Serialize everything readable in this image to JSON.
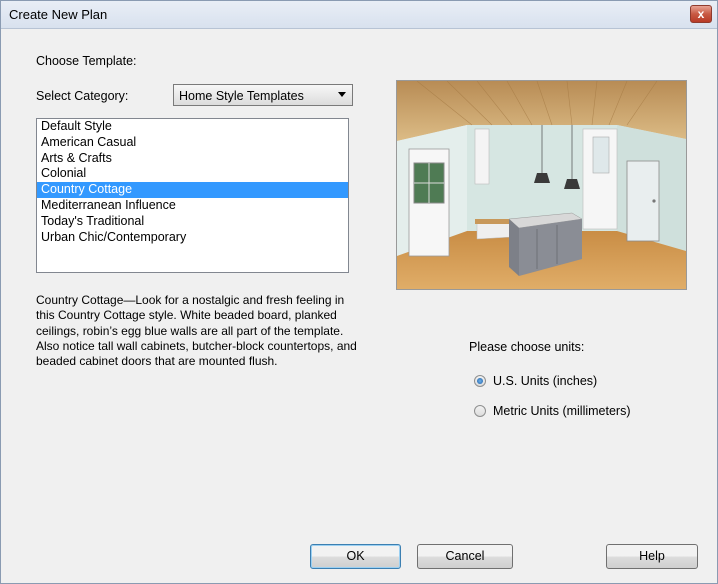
{
  "window": {
    "title": "Create New Plan",
    "close_label": "x"
  },
  "choose_template_label": "Choose Template:",
  "category": {
    "label": "Select Category:",
    "selected": "Home Style Templates"
  },
  "templates": [
    {
      "label": "Default Style",
      "selected": false
    },
    {
      "label": "American Casual",
      "selected": false
    },
    {
      "label": "Arts & Crafts",
      "selected": false
    },
    {
      "label": "Colonial",
      "selected": false
    },
    {
      "label": "Country Cottage",
      "selected": true
    },
    {
      "label": "Mediterranean Influence",
      "selected": false
    },
    {
      "label": "Today's Traditional",
      "selected": false
    },
    {
      "label": "Urban Chic/Contemporary",
      "selected": false
    }
  ],
  "description": "Country Cottage—Look for a nostalgic and fresh feeling in this Country Cottage style. White beaded board, planked ceilings, robin’s egg blue walls are all part of the template. Also notice tall wall cabinets, butcher-block countertops, and beaded cabinet doors that are mounted flush.",
  "units": {
    "label": "Please choose units:",
    "options": [
      {
        "label": "U.S. Units (inches)",
        "checked": true
      },
      {
        "label": "Metric Units (millimeters)",
        "checked": false
      }
    ]
  },
  "buttons": {
    "ok": "OK",
    "cancel": "Cancel",
    "help": "Help"
  },
  "colors": {
    "selection": "#3399ff",
    "ceiling": "#c9a471",
    "walls": "#d6e6e2",
    "floor": "#d49a52",
    "island": "#8a8d95"
  }
}
